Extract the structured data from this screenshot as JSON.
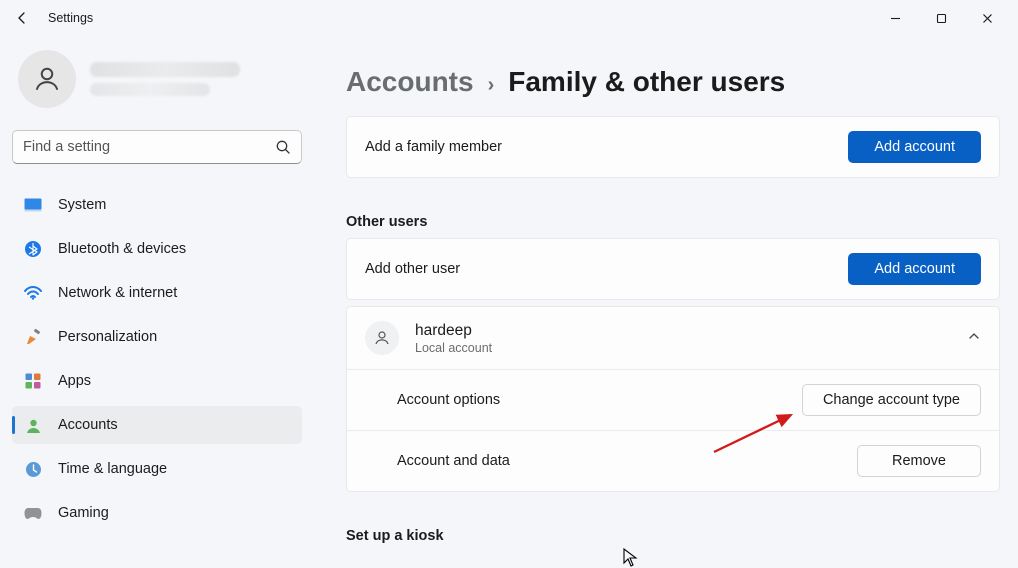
{
  "app": {
    "title": "Settings"
  },
  "search": {
    "placeholder": "Find a setting"
  },
  "nav": {
    "items": [
      {
        "id": "system",
        "label": "System"
      },
      {
        "id": "bluetooth",
        "label": "Bluetooth & devices"
      },
      {
        "id": "network",
        "label": "Network & internet"
      },
      {
        "id": "personalization",
        "label": "Personalization"
      },
      {
        "id": "apps",
        "label": "Apps"
      },
      {
        "id": "accounts",
        "label": "Accounts"
      },
      {
        "id": "time",
        "label": "Time & language"
      },
      {
        "id": "gaming",
        "label": "Gaming"
      }
    ],
    "active": "accounts"
  },
  "breadcrumb": {
    "parent": "Accounts",
    "title": "Family & other users"
  },
  "family": {
    "add_label": "Add a family member",
    "add_button": "Add account"
  },
  "other_users": {
    "section_label": "Other users",
    "add_label": "Add other user",
    "add_button": "Add account",
    "user": {
      "name": "hardeep",
      "type": "Local account",
      "options_label": "Account options",
      "change_type_button": "Change account type",
      "data_label": "Account and data",
      "remove_button": "Remove"
    }
  },
  "kiosk": {
    "section_label": "Set up a kiosk"
  }
}
